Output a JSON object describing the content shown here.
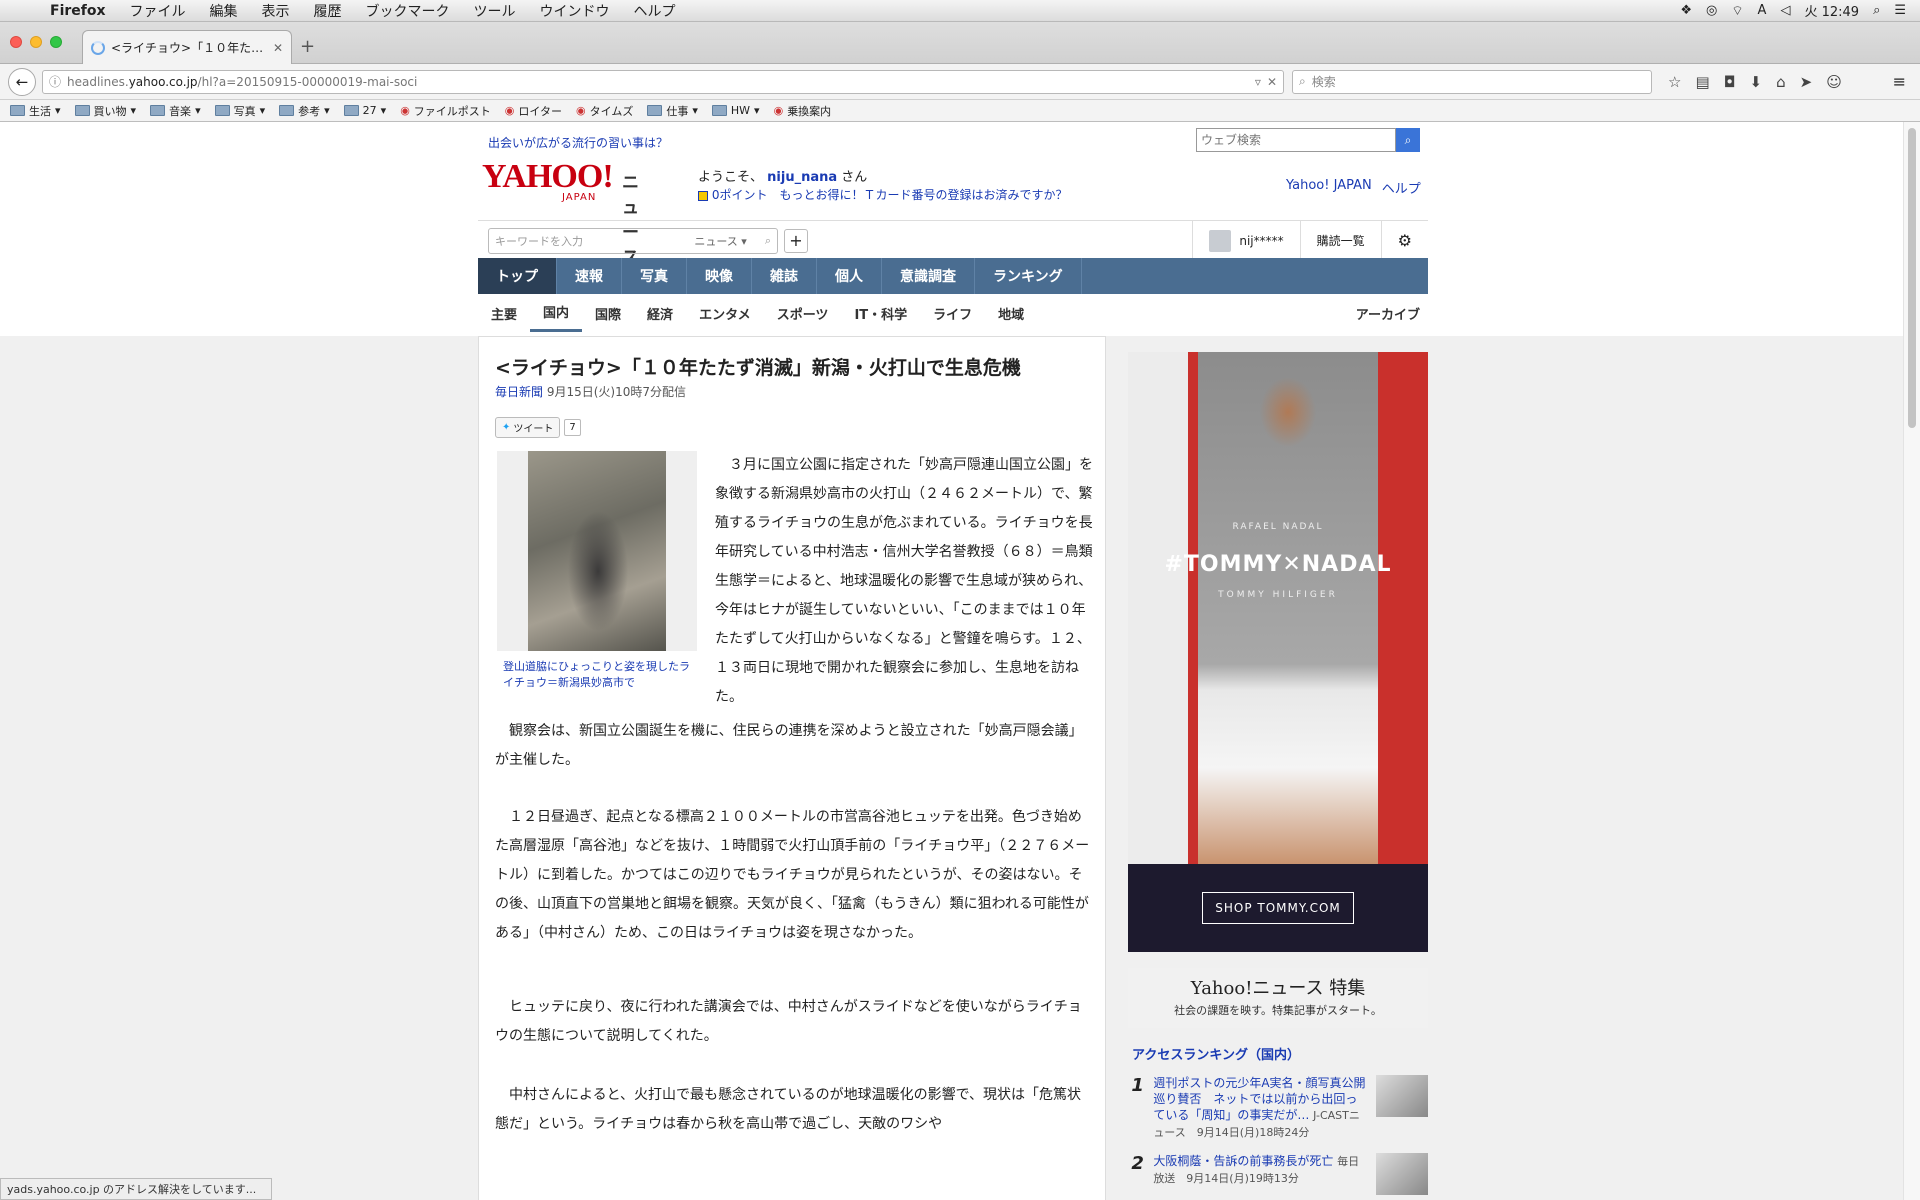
{
  "macbar": {
    "menus": [
      "Firefox",
      "ファイル",
      "編集",
      "表示",
      "履歴",
      "ブックマーク",
      "ツール",
      "ウインドウ",
      "ヘルプ"
    ],
    "input_indicator": "A",
    "clock": "火 12:49"
  },
  "tab": {
    "title": "<ライチョウ>「１０年た…"
  },
  "urlbar": {
    "url_prefix": "headlines.",
    "url_domain": "yahoo.co.jp",
    "url_suffix": "/hl?a=20150915-00000019-mai-soci"
  },
  "searchbar": {
    "placeholder": "検索"
  },
  "bookmarks": [
    {
      "label": "生活",
      "folder": true
    },
    {
      "label": "買い物",
      "folder": true
    },
    {
      "label": "音楽",
      "folder": true
    },
    {
      "label": "写真",
      "folder": true
    },
    {
      "label": "参考",
      "folder": true
    },
    {
      "label": "27",
      "folder": true
    },
    {
      "label": "ファイルポスト",
      "folder": false
    },
    {
      "label": "ロイター",
      "folder": false
    },
    {
      "label": "タイムズ",
      "folder": false
    },
    {
      "label": "仕事",
      "folder": true
    },
    {
      "label": "HW",
      "folder": true
    },
    {
      "label": "乗換案内",
      "folder": false
    }
  ],
  "page": {
    "top_link": "出会いが広がる流行の習い事は？",
    "web_search_placeholder": "ウェブ検索",
    "logo_text": "YAHOO!",
    "logo_sub": "JAPAN",
    "logo_news": "ニュース",
    "welcome_prefix": "ようこそ、",
    "username": "niju_nana",
    "welcome_suffix": "さん",
    "tcard": "0ポイント　もっとお得に！Ｔカード番号の登録はお済みですか？",
    "right_links": [
      "Yahoo! JAPAN",
      "ヘルプ"
    ],
    "keyword_placeholder": "キーワードを入力",
    "keyword_category": "ニュース",
    "user_short": "nij*****",
    "subscriptions": "購読一覧",
    "main_nav": [
      "トップ",
      "速報",
      "写真",
      "映像",
      "雑誌",
      "個人",
      "意識調査",
      "ランキング"
    ],
    "sub_nav": [
      "主要",
      "国内",
      "国際",
      "経済",
      "エンタメ",
      "スポーツ",
      "IT・科学",
      "ライフ",
      "地域"
    ],
    "archive": "アーカイブ"
  },
  "article": {
    "headline": "<ライチョウ>「１０年たたず消滅」新潟・火打山で生息危機",
    "source": "毎日新聞",
    "date": "9月15日(火)10時7分配信",
    "tweet_label": "ツイート",
    "tweet_count": "7",
    "caption": "登山道脇にひょっこりと姿を現したライチョウ＝新潟県妙高市で",
    "lead": "　３月に国立公園に指定された「妙高戸隠連山国立公園」を象徴する新潟県妙高市の火打山（２４６２メートル）で、繁殖するライチョウの生息が危ぶまれている。ライチョウを長年研究している中村浩志・信州大学名誉教授（６８）＝鳥類生態学＝によると、地球温暖化の影響で生息域が狭められ、今年はヒナが誕生していないといい、「このままでは１０年たたずして火打山からいなくなる」と警鐘を鳴らす。１２、１３両日に現地で開かれた観察会に参加し、生息地を訪ねた。",
    "paragraphs": [
      "　観察会は、新国立公園誕生を機に、住民らの連携を深めようと設立された「妙高戸隠会議」が主催した。",
      "　１２日昼過ぎ、起点となる標高２１００メートルの市営高谷池ヒュッテを出発。色づき始めた高層湿原「高谷池」などを抜け、１時間弱で火打山頂手前の「ライチョウ平」（２２７６メートル）に到着した。かつてはこの辺りでもライチョウが見られたというが、その姿はない。その後、山頂直下の営巣地と餌場を観察。天気が良く、「猛禽（もうきん）類に狙われる可能性がある」（中村さん）ため、この日はライチョウは姿を現さなかった。",
      "　ヒュッテに戻り、夜に行われた講演会では、中村さんがスライドなどを使いながらライチョウの生態について説明してくれた。",
      "　中村さんによると、火打山で最も懸念されているのが地球温暖化の影響で、現状は「危篤状態だ」という。ライチョウは春から秋を高山帯で過ごし、天敵のワシや"
    ]
  },
  "ad": {
    "name": "RAFAEL NADAL",
    "title": "#TOMMY✕NADAL",
    "brand": "TOMMY HILFIGER",
    "cta": "SHOP TOMMY.COM"
  },
  "special": {
    "title": "Yahoo!ニュース 特集",
    "subtitle": "社会の課題を映す。特集記事がスタート。"
  },
  "ranking": {
    "heading": "アクセスランキング（国内）",
    "items": [
      {
        "num": "1",
        "text": "週刊ポストの元少年A実名・顔写真公開巡り賛否　ネットでは以前から出回っている「周知」の事実だが…",
        "src": "J-CASTニュース　9月14日(月)18時24分"
      },
      {
        "num": "2",
        "text": "大阪桐蔭・告訴の前事務長が死亡",
        "src": "毎日放送　9月14日(月)19時13分"
      }
    ]
  },
  "status": "yads.yahoo.co.jp のアドレス解決をしています..."
}
